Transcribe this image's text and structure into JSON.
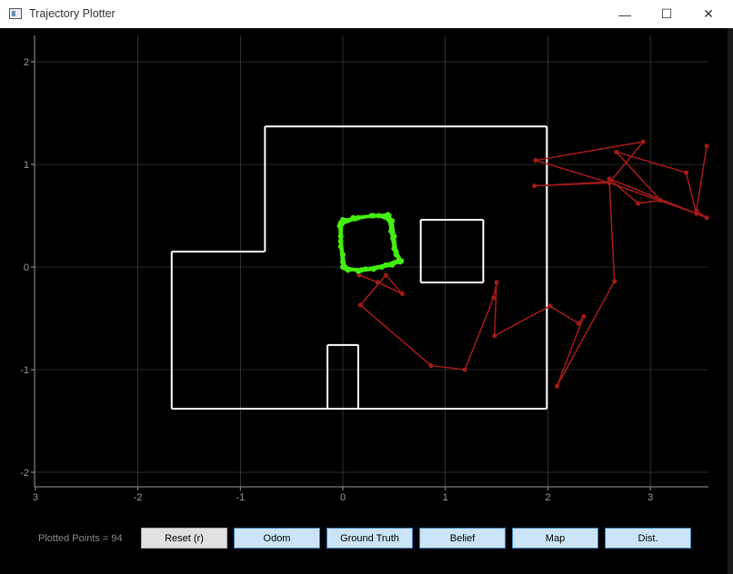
{
  "window": {
    "title": "Trajectory Plotter",
    "minimize_glyph": "—",
    "maximize_glyph": "☐",
    "close_glyph": "✕"
  },
  "status": {
    "points_label": "Plotted Points = 94"
  },
  "buttons": {
    "reset": "Reset (r)",
    "odom": "Odom",
    "ground_truth": "Ground Truth",
    "belief": "Belief",
    "map": "Map",
    "dist": "Dist."
  },
  "colors": {
    "background": "#000000",
    "map": "#ffffff",
    "odom": "#a01a1a",
    "ground_truth": "#44ee11",
    "grid": "#505050"
  },
  "chart_data": {
    "type": "scatter",
    "grid": true,
    "xlim": [
      -3.0,
      3.55
    ],
    "ylim": [
      -2.15,
      2.25
    ],
    "x_ticks": [
      -3,
      -2,
      -1,
      0,
      1,
      2,
      3
    ],
    "x_tick_labels": [
      "3",
      "-2",
      "-1",
      "0",
      "1",
      "2",
      "3"
    ],
    "y_ticks": [
      2,
      1,
      0,
      -1,
      -2
    ],
    "y_tick_labels": [
      "2",
      "1",
      "0",
      "-1",
      "-2"
    ],
    "map_segments": [
      [
        [
          -0.76,
          1.37
        ],
        [
          1.99,
          1.37
        ]
      ],
      [
        [
          1.99,
          1.37
        ],
        [
          1.99,
          -1.38
        ]
      ],
      [
        [
          1.99,
          -1.38
        ],
        [
          -1.67,
          -1.38
        ]
      ],
      [
        [
          -1.67,
          -1.38
        ],
        [
          -1.67,
          0.15
        ]
      ],
      [
        [
          -1.67,
          0.15
        ],
        [
          -0.76,
          0.15
        ]
      ],
      [
        [
          -0.76,
          0.15
        ],
        [
          -0.76,
          1.37
        ]
      ],
      [
        [
          0.76,
          0.46
        ],
        [
          1.37,
          0.46
        ]
      ],
      [
        [
          1.37,
          0.46
        ],
        [
          1.37,
          -0.15
        ]
      ],
      [
        [
          1.37,
          -0.15
        ],
        [
          0.76,
          -0.15
        ]
      ],
      [
        [
          0.76,
          -0.15
        ],
        [
          0.76,
          0.46
        ]
      ],
      [
        [
          -0.15,
          -0.76
        ],
        [
          0.15,
          -0.76
        ]
      ],
      [
        [
          0.15,
          -0.76
        ],
        [
          0.15,
          -1.38
        ]
      ],
      [
        [
          -0.15,
          -0.76
        ],
        [
          -0.15,
          -1.38
        ]
      ]
    ],
    "series": [
      {
        "key": "ground_truth",
        "points": [
          [
            0.0,
            0.0
          ],
          [
            -0.02,
            0.2
          ],
          [
            -0.03,
            0.4
          ],
          [
            0.0,
            0.46
          ],
          [
            0.12,
            0.47
          ],
          [
            0.3,
            0.5
          ],
          [
            0.44,
            0.51
          ],
          [
            0.48,
            0.45
          ],
          [
            0.5,
            0.3
          ],
          [
            0.52,
            0.15
          ],
          [
            0.57,
            0.06
          ],
          [
            0.48,
            0.02
          ],
          [
            0.3,
            -0.02
          ],
          [
            0.15,
            -0.04
          ],
          [
            0.02,
            0.0
          ],
          [
            0.0,
            0.12
          ],
          [
            -0.02,
            0.3
          ],
          [
            -0.02,
            0.43
          ],
          [
            0.1,
            0.48
          ],
          [
            0.28,
            0.5
          ],
          [
            0.45,
            0.5
          ],
          [
            0.47,
            0.35
          ],
          [
            0.5,
            0.18
          ],
          [
            0.55,
            0.07
          ],
          [
            0.42,
            0.02
          ],
          [
            0.22,
            -0.02
          ],
          [
            0.05,
            -0.03
          ],
          [
            0.0,
            0.05
          ],
          [
            -0.02,
            0.25
          ],
          [
            -0.01,
            0.42
          ],
          [
            0.15,
            0.48
          ],
          [
            0.35,
            0.5
          ],
          [
            0.45,
            0.46
          ],
          [
            0.49,
            0.28
          ],
          [
            0.52,
            0.12
          ],
          [
            0.56,
            0.05
          ],
          [
            0.38,
            0.0
          ],
          [
            0.18,
            -0.03
          ],
          [
            0.02,
            -0.01
          ]
        ]
      },
      {
        "key": "odom",
        "points": [
          [
            0.16,
            -0.08
          ],
          [
            0.34,
            -0.15
          ],
          [
            0.58,
            -0.26
          ],
          [
            0.42,
            -0.08
          ],
          [
            0.17,
            -0.37
          ],
          [
            0.86,
            -0.96
          ],
          [
            1.19,
            -1.0
          ],
          [
            1.47,
            -0.3
          ],
          [
            1.5,
            -0.15
          ],
          [
            1.48,
            -0.67
          ],
          [
            2.02,
            -0.38
          ],
          [
            2.3,
            -0.55
          ],
          [
            2.35,
            -0.48
          ],
          [
            2.09,
            -1.16
          ],
          [
            2.65,
            -0.14
          ],
          [
            2.6,
            0.83
          ],
          [
            1.87,
            0.79
          ],
          [
            2.6,
            0.82
          ],
          [
            2.93,
            1.22
          ],
          [
            1.88,
            1.04
          ],
          [
            2.6,
            0.82
          ],
          [
            3.45,
            0.52
          ],
          [
            3.35,
            0.92
          ],
          [
            2.67,
            1.12
          ],
          [
            3.1,
            0.65
          ],
          [
            2.88,
            0.62
          ],
          [
            2.6,
            0.86
          ],
          [
            3.55,
            0.48
          ],
          [
            3.45,
            0.55
          ],
          [
            3.55,
            1.18
          ]
        ]
      }
    ]
  }
}
